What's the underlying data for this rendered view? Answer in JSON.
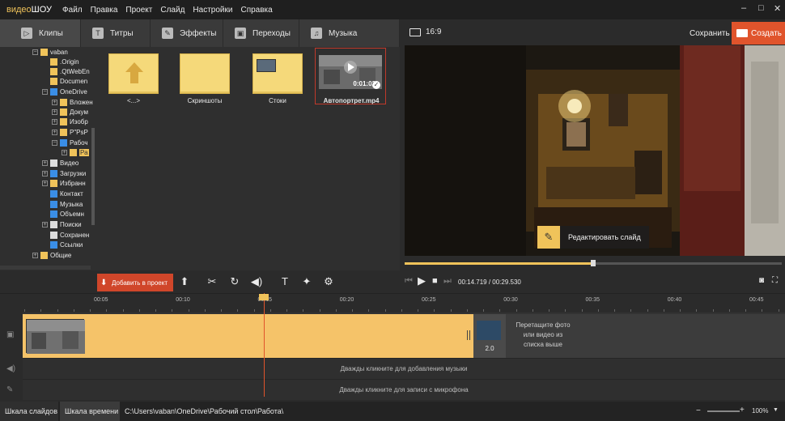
{
  "window": {
    "logo_a": "видео",
    "logo_b": "ШОУ",
    "minimize": "–",
    "maximize": "□",
    "close": "✕"
  },
  "menu": [
    "Файл",
    "Правка",
    "Проект",
    "Слайд",
    "Настройки",
    "Справка"
  ],
  "tabs": [
    {
      "label": "Клипы",
      "icon": "▷"
    },
    {
      "label": "Титры",
      "icon": "T"
    },
    {
      "label": "Эффекты",
      "icon": "✎"
    },
    {
      "label": "Переходы",
      "icon": "▣"
    },
    {
      "label": "Музыка",
      "icon": "♫"
    }
  ],
  "preview_header": {
    "aspect": "16:9",
    "save_label": "Сохранить",
    "create_label": "Создать"
  },
  "tree": [
    {
      "label": "vaban",
      "indent": 3,
      "expand": "−"
    },
    {
      "label": ".Origin",
      "indent": 4,
      "expand": ""
    },
    {
      "label": ".QtWebEn",
      "indent": 4,
      "expand": ""
    },
    {
      "label": "Documen",
      "indent": 4,
      "expand": ""
    },
    {
      "label": "OneDrive",
      "indent": 4,
      "expand": "−"
    },
    {
      "label": "Вложен",
      "indent": 5,
      "expand": "+"
    },
    {
      "label": "Докум",
      "indent": 5,
      "expand": "+"
    },
    {
      "label": "Изобр",
      "indent": 5,
      "expand": "+"
    },
    {
      "label": "P\"PsP",
      "indent": 5,
      "expand": "+"
    },
    {
      "label": "Рабоч",
      "indent": 5,
      "expand": "−"
    },
    {
      "label": "Ра",
      "indent": 6,
      "expand": "+"
    },
    {
      "label": "Видео",
      "indent": 4,
      "expand": "+"
    },
    {
      "label": "Загрузки",
      "indent": 4,
      "expand": "+"
    },
    {
      "label": "Избранн",
      "indent": 4,
      "expand": "+"
    },
    {
      "label": "Контакт",
      "indent": 4,
      "expand": ""
    },
    {
      "label": "Музыка",
      "indent": 4,
      "expand": ""
    },
    {
      "label": "Объемн",
      "indent": 4,
      "expand": ""
    },
    {
      "label": "Поиски",
      "indent": 4,
      "expand": "+"
    },
    {
      "label": "Сохранен",
      "indent": 4,
      "expand": ""
    },
    {
      "label": "Ссылки",
      "indent": 4,
      "expand": ""
    },
    {
      "label": "Общие",
      "indent": 3,
      "expand": "+"
    }
  ],
  "files": [
    {
      "label": "<...>",
      "kind": "up"
    },
    {
      "label": "Скриншоты",
      "kind": "folder"
    },
    {
      "label": "Стоки",
      "kind": "folder"
    },
    {
      "label": "Автопортрет.mp4",
      "kind": "video",
      "duration": "0:01:02"
    }
  ],
  "toolbar": {
    "add_label": "Добавить в проект"
  },
  "preview": {
    "edit_label": "Редактировать слайд",
    "progress": 0.5
  },
  "playback": {
    "current": "00:14.719",
    "total": "00:29.530",
    "separator": " / "
  },
  "ruler_labels": [
    "00:05",
    "00:10",
    "00:15",
    "00:20",
    "00:25",
    "00:30",
    "00:35",
    "00:40",
    "00:45"
  ],
  "timeline": {
    "transition_duration": "2.0",
    "drop_hint": "Перетащите фото или видео из списка выше",
    "music_hint": "Дважды кликните для добавления музыки",
    "mic_hint": "Дважды кликните для записи с микрофона"
  },
  "statusbar": {
    "slides_tab": "Шкала слайдов",
    "timeline_tab": "Шкала времени",
    "path": "C:\\Users\\vaban\\OneDrive\\Рабочий стол\\Работа\\",
    "zoom": "100%"
  },
  "colors": {
    "accent": "#f0c35a",
    "create": "#e0542c",
    "add": "#d0462a"
  }
}
